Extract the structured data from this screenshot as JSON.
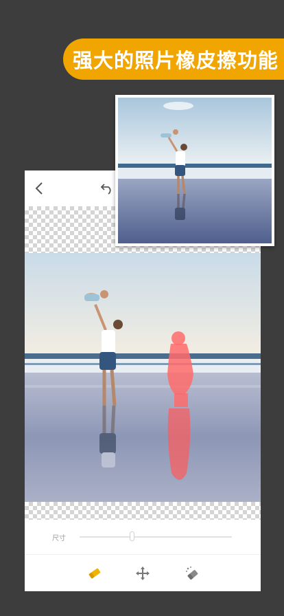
{
  "banner": {
    "title": "强大的照片橡皮擦功能"
  },
  "colors": {
    "accent": "#f0a500",
    "background": "#3d3d3d",
    "selection": "#ff5a5a"
  },
  "editor": {
    "topbar": {
      "back_icon": "chevron-left-icon",
      "undo_icon": "undo-arrow-icon"
    },
    "controls": {
      "size_label": "尺寸",
      "size_value": 0.35
    },
    "toolbar": {
      "tools": [
        "eraser-icon",
        "move-icon",
        "magic-eraser-icon"
      ],
      "active_tool": "eraser-icon"
    }
  },
  "inset": {
    "description_icon": "before-photo"
  }
}
